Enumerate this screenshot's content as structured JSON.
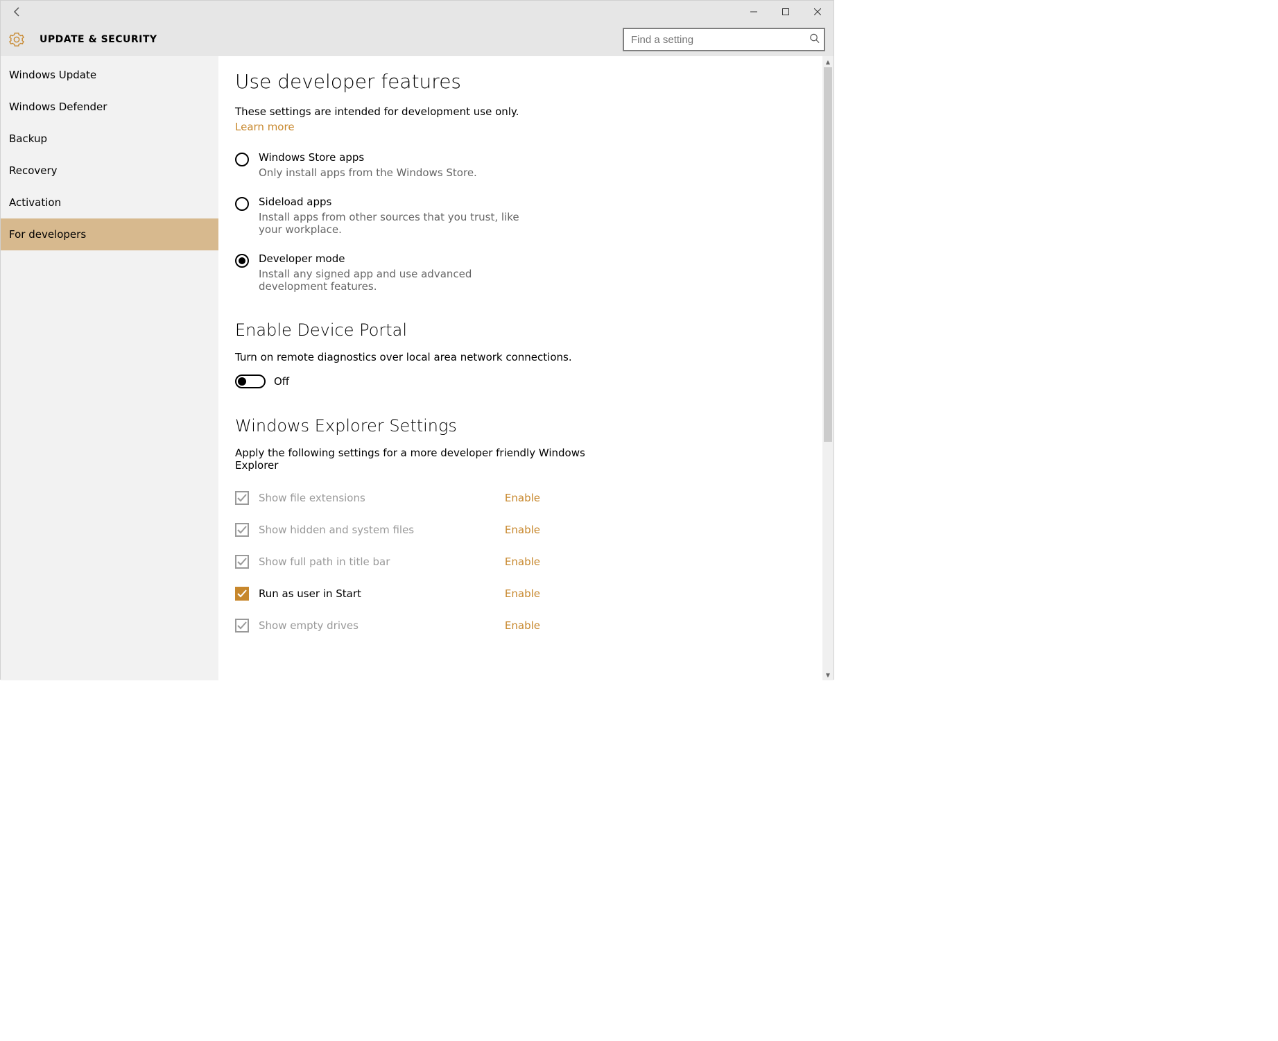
{
  "colors": {
    "accent": "#c7872c",
    "sidebar_active": "#d7b98e"
  },
  "header": {
    "title": "UPDATE & SECURITY",
    "search_placeholder": "Find a setting"
  },
  "sidebar": {
    "items": [
      {
        "label": "Windows Update",
        "active": false
      },
      {
        "label": "Windows Defender",
        "active": false
      },
      {
        "label": "Backup",
        "active": false
      },
      {
        "label": "Recovery",
        "active": false
      },
      {
        "label": "Activation",
        "active": false
      },
      {
        "label": "For developers",
        "active": true
      }
    ]
  },
  "main": {
    "section1": {
      "heading": "Use developer features",
      "desc": "These settings are intended for development use only.",
      "link": "Learn more",
      "options": [
        {
          "label": "Windows Store apps",
          "sub": "Only install apps from the Windows Store.",
          "selected": false
        },
        {
          "label": "Sideload apps",
          "sub": "Install apps from other sources that you trust, like your workplace.",
          "selected": false
        },
        {
          "label": "Developer mode",
          "sub": "Install any signed app and use advanced development features.",
          "selected": true
        }
      ]
    },
    "section2": {
      "heading": "Enable Device Portal",
      "desc": "Turn on remote diagnostics over local area network connections.",
      "toggle_label": "Off",
      "toggle_on": false
    },
    "section3": {
      "heading": "Windows Explorer Settings",
      "desc": "Apply the following settings for a more developer friendly Windows Explorer",
      "enable_label": "Enable",
      "items": [
        {
          "label": "Show file extensions",
          "checked": true,
          "disabled": true
        },
        {
          "label": "Show hidden and system files",
          "checked": true,
          "disabled": true
        },
        {
          "label": "Show full path in title bar",
          "checked": true,
          "disabled": true
        },
        {
          "label": "Run as user in Start",
          "checked": true,
          "disabled": false
        },
        {
          "label": "Show empty drives",
          "checked": true,
          "disabled": true
        }
      ]
    }
  }
}
